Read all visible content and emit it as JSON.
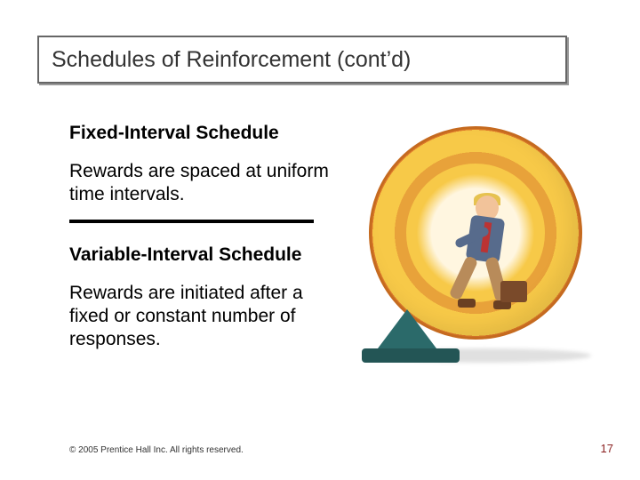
{
  "title": "Schedules of Reinforcement (cont’d)",
  "sections": [
    {
      "heading": "Fixed-Interval Schedule",
      "body": "Rewards are spaced at uniform time intervals."
    },
    {
      "heading": "Variable-Interval Schedule",
      "body": "Rewards are initiated after a fixed or constant number of responses."
    }
  ],
  "illustration": {
    "name": "man-running-in-hamster-wheel"
  },
  "footer": {
    "copyright": "© 2005 Prentice Hall Inc. All rights reserved.",
    "page_number": "17"
  }
}
